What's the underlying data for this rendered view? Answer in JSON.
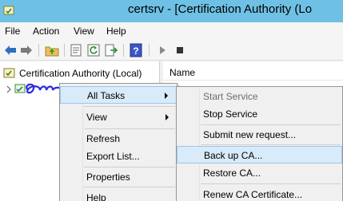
{
  "window": {
    "title": "certsrv - [Certification Authority (Lo"
  },
  "menubar": {
    "items": [
      "File",
      "Action",
      "View",
      "Help"
    ]
  },
  "toolbar": {
    "icons": [
      "back-icon",
      "forward-icon",
      "up-folder-icon",
      "properties-icon",
      "refresh-icon",
      "export-icon",
      "help-icon",
      "start-icon",
      "stop-icon"
    ]
  },
  "tree": {
    "root_label": "Certification Authority (Local)"
  },
  "list": {
    "column_name": "Name"
  },
  "context_menu": {
    "items": [
      "All Tasks",
      "View",
      "Refresh",
      "Export List...",
      "Properties",
      "Help"
    ]
  },
  "submenu": {
    "items": [
      "Start Service",
      "Stop Service",
      "Submit new request...",
      "Back up CA...",
      "Restore CA...",
      "Renew CA Certificate..."
    ]
  },
  "colors": {
    "titlebar": "#6ec1e4",
    "highlight": "#d9ebf9",
    "highlight_border": "#9bc6ec"
  }
}
